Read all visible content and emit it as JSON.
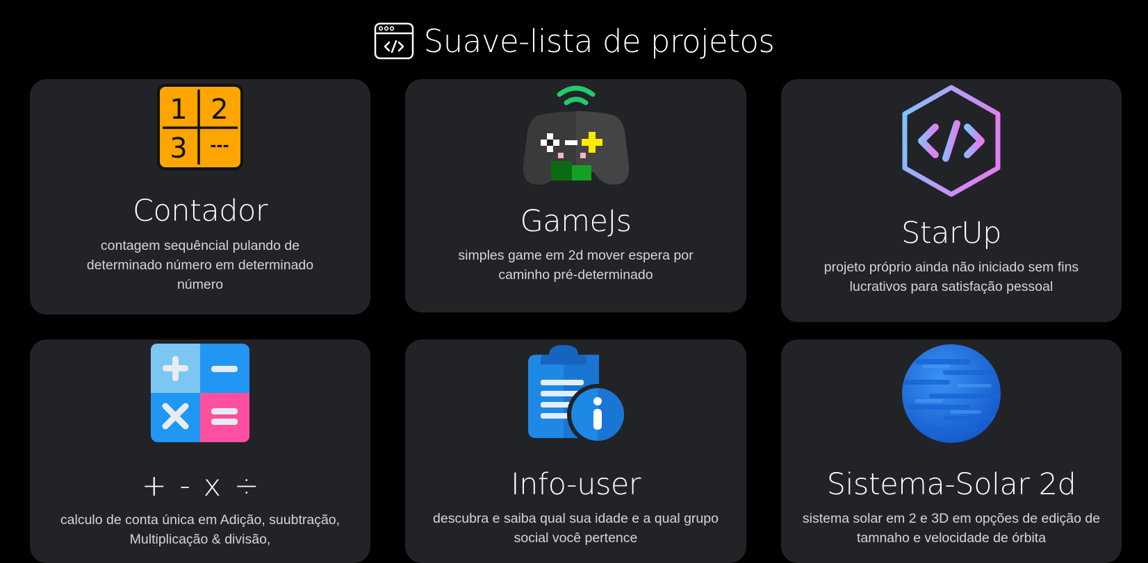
{
  "header": {
    "title": "Suave-lista de projetos",
    "icon": "code-window-icon"
  },
  "projects": [
    {
      "title": "Contador",
      "description": "contagem sequêncial pulando de determinado número em determinado número",
      "icon": "counter-grid-icon",
      "icon_text": [
        "1",
        "2",
        "3",
        "---"
      ]
    },
    {
      "title": "GameJs",
      "description": "simples game em 2d mover espera por caminho pré-determinado",
      "icon": "gamepad-icon"
    },
    {
      "title": "StarUp",
      "description": "projeto próprio ainda não iniciado sem fins lucrativos para satisfação pessoal",
      "icon": "hexagon-code-icon"
    },
    {
      "title": "+ - x ÷",
      "description": "calculo de conta única em Adição, suubtração, Multiplicação & divisão,",
      "icon": "calculator-icon"
    },
    {
      "title": "Info-user",
      "description": "descubra e saiba qual sua idade e a qual grupo social você pertence",
      "icon": "clipboard-info-icon"
    },
    {
      "title": "Sistema-Solar 2d",
      "description": "sistema solar em 2 e 3D em opções de edição de tamnaho e velocidade de órbita",
      "icon": "planet-icon"
    }
  ],
  "colors": {
    "background": "#000000",
    "card": "#222327",
    "counter_orange": "#ffa500",
    "calc_blue": "#2196f3",
    "calc_light_blue": "#6ec1f4",
    "calc_pink": "#ff4fa0",
    "planet_blue": "#1e78e6"
  }
}
